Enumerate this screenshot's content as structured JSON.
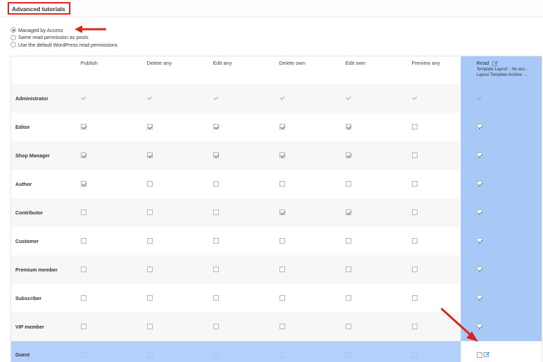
{
  "section": {
    "title": "Advanced tutorials"
  },
  "read_mode": {
    "options": [
      {
        "label": "Managed by Access",
        "selected": true
      },
      {
        "label": "Same read permission as posts",
        "selected": false
      },
      {
        "label": "Use the default WordPress read permissions",
        "selected": false
      }
    ]
  },
  "table": {
    "columns": [
      "",
      "Publish",
      "Delete any",
      "Edit any",
      "Delete own",
      "Edit own",
      "Preview any",
      "Read"
    ],
    "read_column": {
      "label": "Read",
      "template_layout": "Template Layout: : No acc...",
      "layout_template_archive": "Layout Template Archive: ..."
    },
    "rows": [
      {
        "role": "Administrator",
        "values": [
          true,
          true,
          true,
          true,
          true,
          true,
          true
        ],
        "style": "plain"
      },
      {
        "role": "Editor",
        "values": [
          true,
          true,
          true,
          true,
          true,
          false,
          true
        ]
      },
      {
        "role": "Shop Manager",
        "values": [
          true,
          true,
          true,
          true,
          true,
          false,
          true
        ]
      },
      {
        "role": "Author",
        "values": [
          true,
          false,
          false,
          false,
          false,
          false,
          true
        ]
      },
      {
        "role": "Contributor",
        "values": [
          false,
          false,
          false,
          true,
          true,
          false,
          true
        ]
      },
      {
        "role": "Customer",
        "values": [
          false,
          false,
          false,
          false,
          false,
          false,
          true
        ]
      },
      {
        "role": "Premium member",
        "values": [
          false,
          false,
          false,
          false,
          false,
          false,
          true
        ]
      },
      {
        "role": "Subscriber",
        "values": [
          false,
          false,
          false,
          false,
          false,
          false,
          true
        ]
      },
      {
        "role": "VIP member",
        "values": [
          false,
          false,
          false,
          false,
          false,
          false,
          true
        ]
      },
      {
        "role": "Guest",
        "values": [
          false,
          false,
          false,
          false,
          false,
          false,
          false
        ],
        "style": "guest"
      }
    ]
  },
  "colors": {
    "highlight_border": "#e0231b",
    "arrow": "#d9261c",
    "column_highlight": "#a8c9f7",
    "checkbox_check": "#1e73be"
  },
  "icons": {
    "edit": "edit-icon"
  }
}
